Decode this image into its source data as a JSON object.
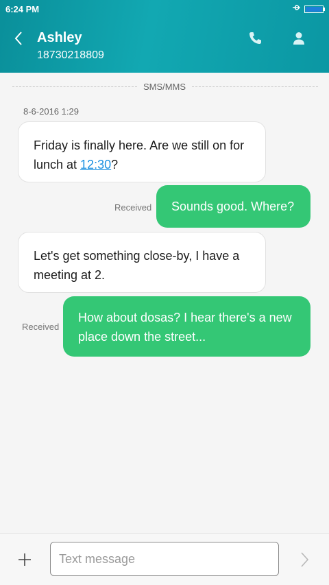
{
  "status_bar": {
    "time": "6:24 PM",
    "usb_icon": "usb-icon"
  },
  "header": {
    "contact_name": "Ashley",
    "phone_number": "18730218809",
    "back_icon": "chevron-left-icon",
    "call_icon": "phone-icon",
    "profile_icon": "person-icon"
  },
  "conversation": {
    "channel_label": "SMS/MMS",
    "date": "8-6-2016 1:29",
    "messages": [
      {
        "direction": "incoming",
        "text_before": "Friday is finally here. Are we still on for lunch at ",
        "link": "12:30",
        "text_after": "?"
      },
      {
        "direction": "outgoing",
        "text": "Sounds good. Where?",
        "status": "Received"
      },
      {
        "direction": "incoming",
        "text": "Let's get something close-by, I have a meeting at 2."
      },
      {
        "direction": "outgoing",
        "text": "How about dosas? I hear there's a new place down the street...",
        "status": "Received"
      }
    ]
  },
  "composer": {
    "attach_icon": "plus-icon",
    "placeholder": "Text message",
    "value": "",
    "send_icon": "chevron-right-icon"
  },
  "colors": {
    "header_teal": "#0a8f9a",
    "outgoing_bubble": "#34c775",
    "link": "#1a90e0",
    "battery": "#1e7fd9"
  }
}
